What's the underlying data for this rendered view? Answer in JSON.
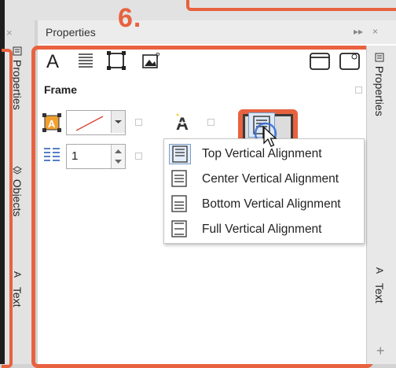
{
  "step_marker": "6.",
  "docker": {
    "title": "Properties",
    "left_close": "×",
    "title_buttons": [
      "▸▸",
      "×"
    ]
  },
  "left_tabs": {
    "properties": "Properties",
    "objects": "Objects",
    "text": "Text"
  },
  "right_tabs": {
    "properties": "Properties",
    "text": "Text",
    "add": "+"
  },
  "toolbar": {
    "character_icon": "text-character-icon",
    "paragraph_icon": "paragraph-icon",
    "frame_icon": "frame-icon",
    "graphic_icon": "graphic-icon"
  },
  "section": {
    "frame_label": "Frame"
  },
  "frame": {
    "columns_value": "1"
  },
  "vertical_alignment_menu": {
    "items": [
      {
        "label": "Top Vertical Alignment",
        "icon": "top-vertical-alignment-icon",
        "selected": true
      },
      {
        "label": "Center Vertical Alignment",
        "icon": "center-vertical-alignment-icon",
        "selected": false
      },
      {
        "label": "Bottom Vertical Alignment",
        "icon": "bottom-vertical-alignment-icon",
        "selected": false
      },
      {
        "label": "Full Vertical Alignment",
        "icon": "full-vertical-alignment-icon",
        "selected": false
      }
    ]
  },
  "colors": {
    "highlight": "#e8623f",
    "frame_fill": "#f0a030",
    "selection": "#e4eefb"
  }
}
